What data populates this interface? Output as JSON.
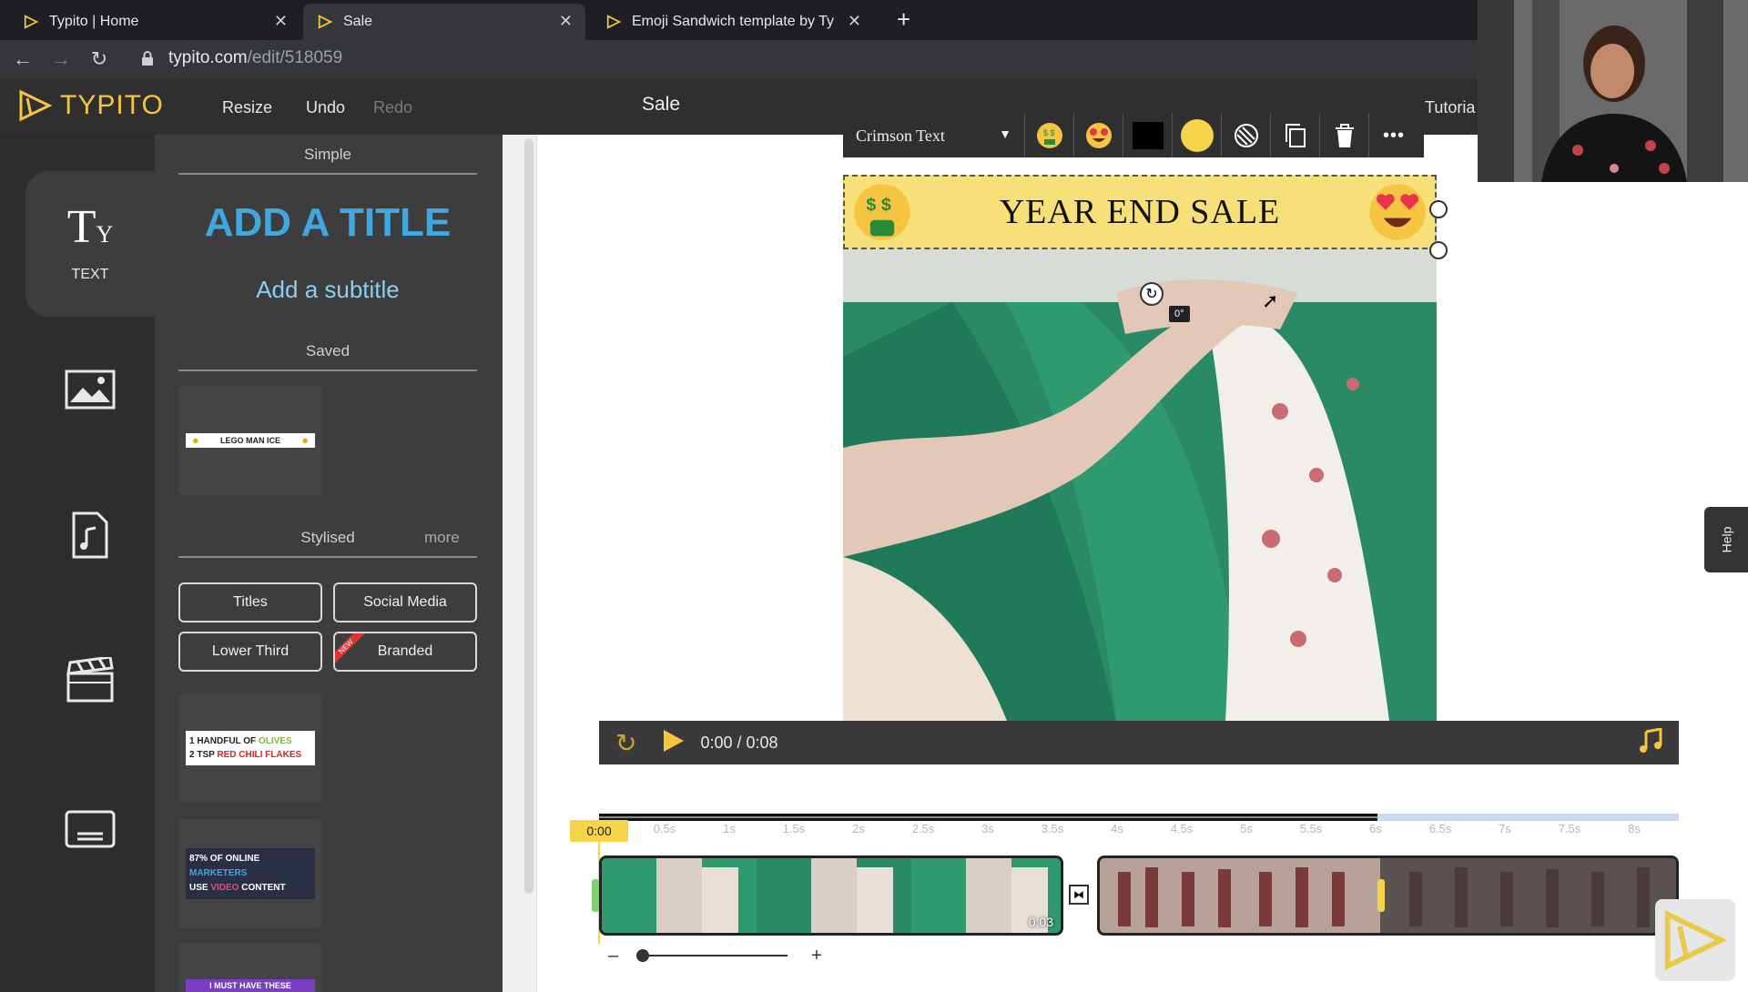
{
  "browser": {
    "tabs": [
      {
        "title": "Typito | Home"
      },
      {
        "title": "Sale"
      },
      {
        "title": "Emoji Sandwich template by Ty"
      }
    ],
    "url_host": "typito.com",
    "url_path": "/edit/518059"
  },
  "header": {
    "logo": "TYPITO",
    "resize": "Resize",
    "undo": "Undo",
    "redo": "Redo",
    "project_title": "Sale",
    "tutorial": "Tutoria"
  },
  "rail": {
    "text_label": "TEXT",
    "text_glyph": "T"
  },
  "panel": {
    "simple_heading": "Simple",
    "add_title": "ADD A TITLE",
    "add_subtitle": "Add a subtitle",
    "saved_heading": "Saved",
    "saved_item_text": "LEGO MAN ICE",
    "stylised_heading": "Stylised",
    "more": "more",
    "buttons": {
      "titles": "Titles",
      "social_media": "Social Media",
      "lower_third": "Lower Third",
      "branded": "Branded",
      "new_badge": "NEW"
    },
    "templates": [
      {
        "line1_a": "1 HANDFUL OF ",
        "line1_b": "OLIVES",
        "line2_a": "2 TSP ",
        "line2_b": "RED CHILI FLAKES"
      },
      {
        "line1_a": "87% OF ONLINE ",
        "line1_b": "MARKETERS",
        "line2_a": "USE ",
        "line2_b": "VIDEO",
        "line2_c": " CONTENT"
      },
      {
        "line1": "I MUST HAVE THESE"
      }
    ]
  },
  "toolbar": {
    "font": "Crimson Text",
    "more": "•••"
  },
  "canvas": {
    "banner_text": "YEAR END SALE",
    "angle": "0°"
  },
  "player": {
    "time": "0:00 / 0:08"
  },
  "timeline": {
    "playhead": "0:00",
    "ticks": [
      "0.5s",
      "1s",
      "1.5s",
      "2s",
      "2.5s",
      "3s",
      "3.5s",
      "4s",
      "4.5s",
      "5s",
      "5.5s",
      "6s",
      "6.5s",
      "7s",
      "7.5s",
      "8s"
    ],
    "clip1_duration": "0:03",
    "zoom_minus": "–",
    "zoom_plus": "+"
  },
  "help": "Help",
  "colors": {
    "accent": "#f5c542",
    "title_blue": "#3ea9e0",
    "banner_yellow": "#f7e07a",
    "text_color_swatch": "#000000",
    "bg_color_swatch": "#f5d44a"
  }
}
